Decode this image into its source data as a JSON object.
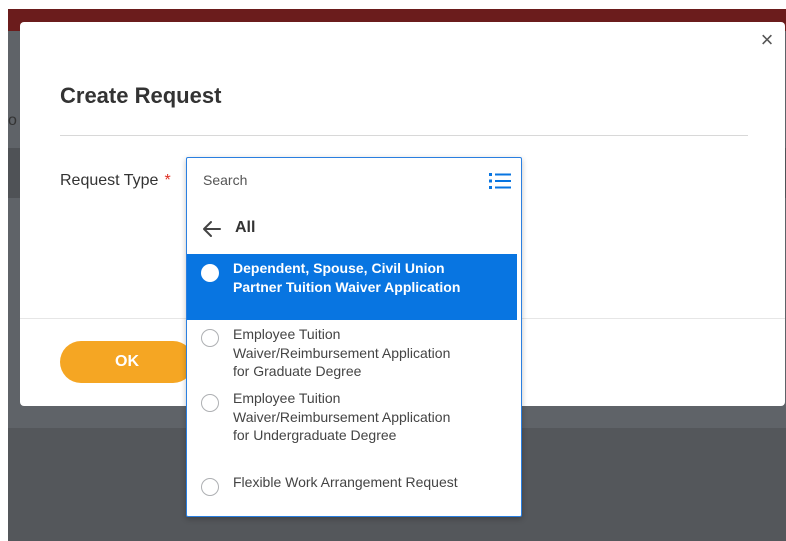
{
  "background": {
    "peek_text": "o"
  },
  "dialog": {
    "title": "Create Request",
    "close_symbol": "×",
    "field_label": "Request Type",
    "required_marker": "*",
    "ok_label": "OK"
  },
  "dropdown": {
    "search_placeholder": "Search",
    "list_icon": "list-view-icon",
    "back_icon": "arrow-left-icon",
    "back_label": "All",
    "options": [
      {
        "label": "Dependent, Spouse, Civil Union Partner Tuition Waiver Application",
        "selected": true
      },
      {
        "label": "Employee Tuition Waiver/Reimbursement Application for Graduate Degree",
        "selected": false
      },
      {
        "label": "Employee Tuition Waiver/Reimbursement Application for Undergraduate Degree",
        "selected": false
      },
      {
        "label": "Flexible Work Arrangement Request",
        "selected": false
      }
    ]
  },
  "colors": {
    "accent_blue": "#0875e1",
    "ok_orange": "#f5a623",
    "required_red": "#de2e21",
    "header_maroon": "#6b1c1c"
  }
}
